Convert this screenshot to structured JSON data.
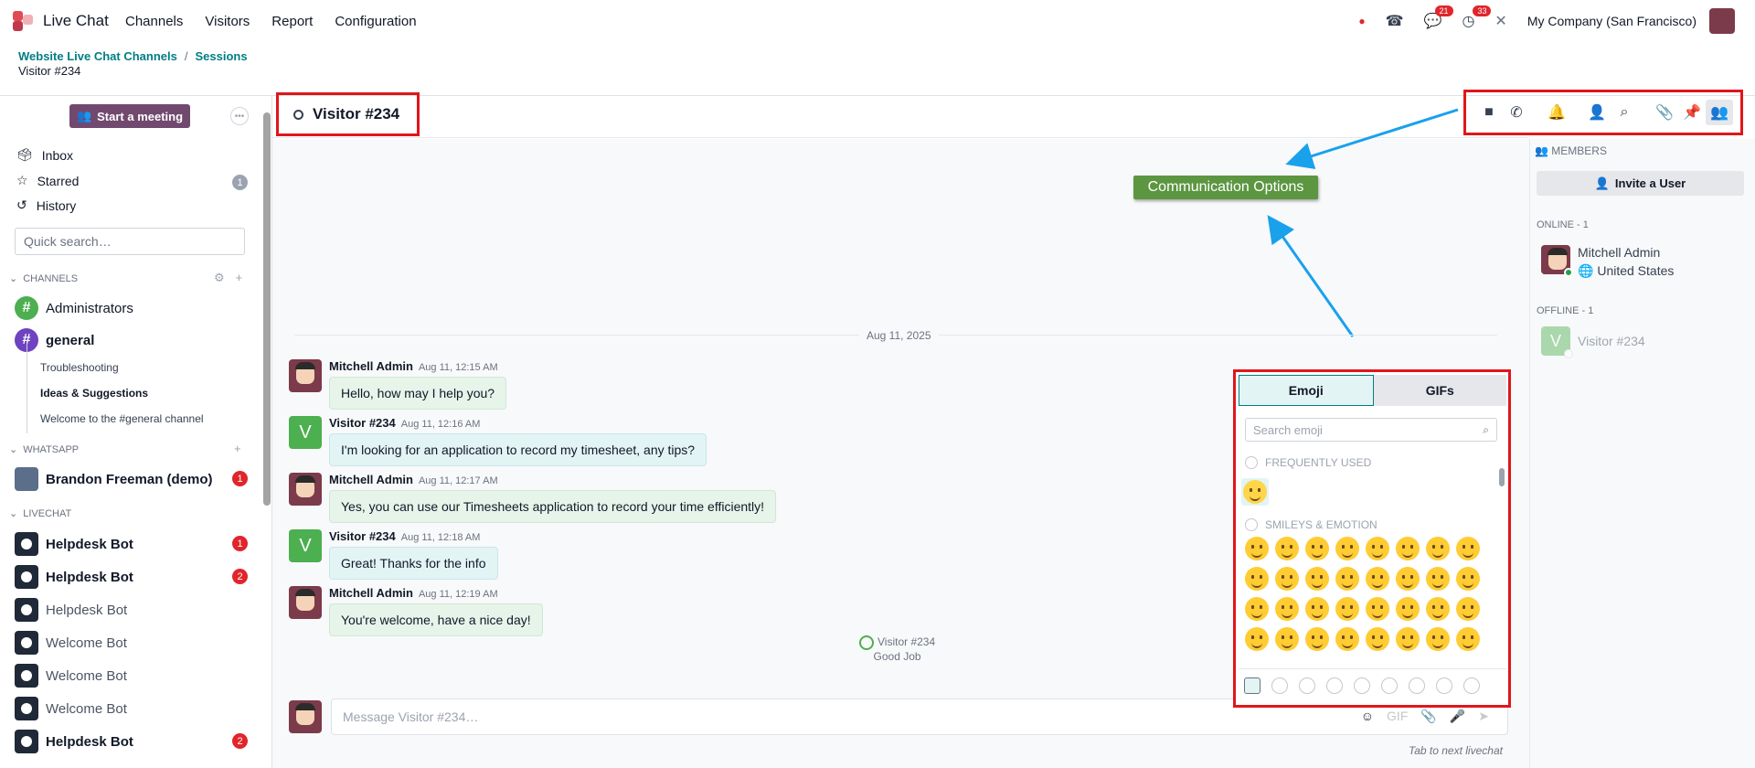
{
  "topbar": {
    "app_name": "Live Chat",
    "menu": [
      "Channels",
      "Visitors",
      "Report",
      "Configuration"
    ],
    "messages_badge": "21",
    "activities_badge": "33",
    "company": "My Company (San Francisco)"
  },
  "breadcrumb": {
    "items": [
      "Website Live Chat Channels",
      "Sessions"
    ],
    "current": "Visitor #234"
  },
  "sidebar": {
    "start_meeting": "Start a meeting",
    "inbox": "Inbox",
    "starred": "Starred",
    "starred_count": "1",
    "history": "History",
    "search_placeholder": "Quick search…",
    "channels_label": "CHANNELS",
    "channels": [
      {
        "name": "Administrators"
      },
      {
        "name": "general"
      }
    ],
    "subchannels": [
      "Troubleshooting",
      "Ideas & Suggestions",
      "Welcome to the #general channel"
    ],
    "whatsapp_label": "WHATSAPP",
    "whatsapp_contact": "Brandon Freeman (demo)",
    "whatsapp_count": "1",
    "livechat_label": "LIVECHAT",
    "livechats": [
      {
        "name": "Helpdesk Bot",
        "count": "1",
        "bold": true
      },
      {
        "name": "Helpdesk Bot",
        "count": "2",
        "bold": true
      },
      {
        "name": "Helpdesk Bot",
        "count": "",
        "bold": false
      },
      {
        "name": "Welcome Bot",
        "count": "",
        "bold": false
      },
      {
        "name": "Welcome Bot",
        "count": "",
        "bold": false
      },
      {
        "name": "Welcome Bot",
        "count": "",
        "bold": false
      },
      {
        "name": "Helpdesk Bot",
        "count": "2",
        "bold": true
      }
    ]
  },
  "thread": {
    "title": "Visitor #234",
    "date": "Aug 11, 2025",
    "messages": [
      {
        "author": "Mitchell Admin",
        "time": "Aug 11, 12:15 AM",
        "text": "Hello, how may I help you?"
      },
      {
        "author": "Visitor #234",
        "time": "Aug 11, 12:16 AM",
        "text": "I'm looking for an application to record my timesheet, any tips?"
      },
      {
        "author": "Mitchell Admin",
        "time": "Aug 11, 12:17 AM",
        "text": "Yes, you can use our Timesheets application to record your time efficiently!"
      },
      {
        "author": "Visitor #234",
        "time": "Aug 11, 12:18 AM",
        "text": "Great! Thanks for the info"
      },
      {
        "author": "Mitchell Admin",
        "time": "Aug 11, 12:19 AM",
        "text": "You're welcome, have a nice day!"
      }
    ],
    "rating_author": "Visitor #234",
    "rating_text": "Good Job",
    "composer_placeholder": "Message Visitor #234…",
    "tab_hint": "Tab to next livechat"
  },
  "annotation": {
    "label": "Communication Options",
    "accent": "#5c9641",
    "highlight": "#e0161b"
  },
  "emoji_picker": {
    "tabs": [
      "Emoji",
      "GIFs"
    ],
    "search_placeholder": "Search emoji",
    "frequently_used": "FREQUENTLY USED",
    "smileys": "SMILEYS & EMOTION"
  },
  "members": {
    "title": "MEMBERS",
    "invite": "Invite a User",
    "online_label": "ONLINE - 1",
    "online_name": "Mitchell Admin",
    "online_country": "United States",
    "offline_label": "OFFLINE - 1",
    "offline_name": "Visitor #234"
  }
}
